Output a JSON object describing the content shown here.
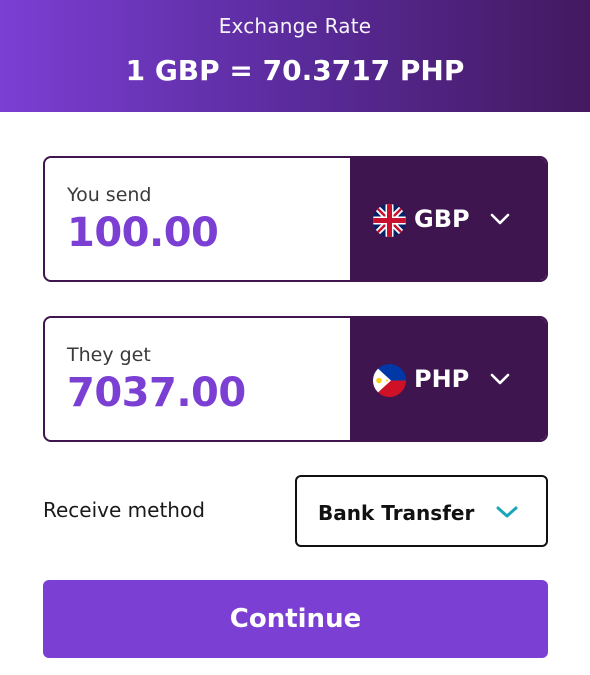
{
  "header": {
    "label": "Exchange Rate",
    "rate": "1 GBP = 70.3717 PHP"
  },
  "send": {
    "caption": "You send",
    "amount": "100.00",
    "currency": "GBP",
    "flag_icon": "uk-flag-icon"
  },
  "receive": {
    "caption": "They get",
    "amount": "7037.00",
    "currency": "PHP",
    "flag_icon": "philippines-flag-icon"
  },
  "method": {
    "label": "Receive method",
    "selected": "Bank Transfer"
  },
  "continue_label": "Continue",
  "colors": {
    "primary": "#7b3fd3",
    "dark": "#3e154f",
    "teal_chevron": "#1aa6b7"
  }
}
